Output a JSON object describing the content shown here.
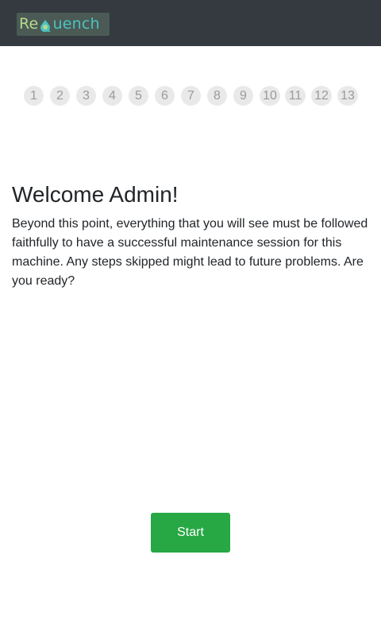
{
  "header": {
    "logo_text_part1": "Re",
    "logo_text_part2": "uench",
    "colors": {
      "bar": "#343a40",
      "logo_green": "#b6d98e",
      "logo_teal": "#4bc3c0"
    }
  },
  "stepper": {
    "steps": [
      "1",
      "2",
      "3",
      "4",
      "5",
      "6",
      "7",
      "8",
      "9",
      "10",
      "11",
      "12",
      "13"
    ],
    "current_step": 0
  },
  "main": {
    "title": "Welcome Admin!",
    "intro": "Beyond this point, everything that you will see must be followed faithfully to have a successful maintenance session for this machine. Any steps skipped might lead to future problems. Are you ready?",
    "start_label": "Start",
    "start_color": "#28a745"
  }
}
